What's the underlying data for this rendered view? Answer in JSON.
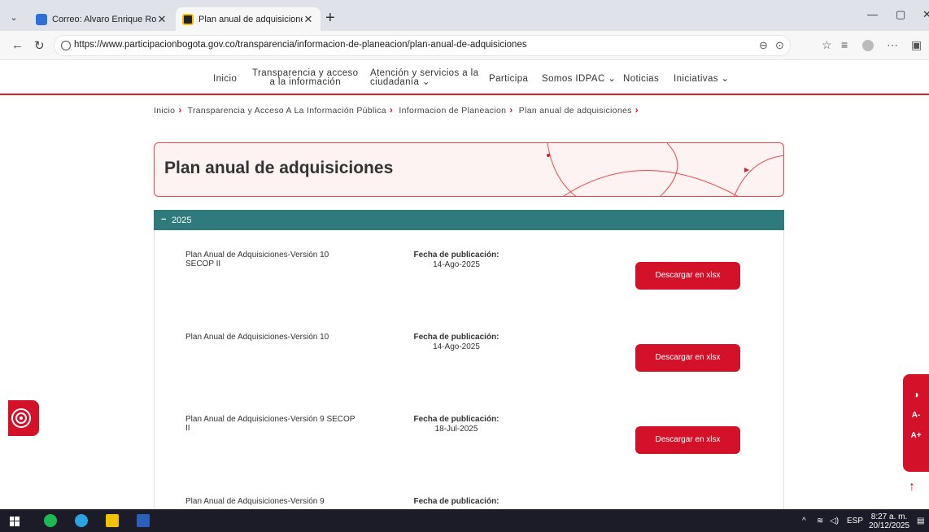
{
  "browser": {
    "tabs": [
      {
        "title": "Correo: Alvaro Enrique Romero Ga",
        "active": false
      },
      {
        "title": "Plan anual de adquisiciones | Instit",
        "active": true
      }
    ],
    "url": "https://www.participacionbogota.gov.co/transparencia/informacion-de-planeacion/plan-anual-de-adquisiciones"
  },
  "nav": {
    "inicio": "Inicio",
    "transparencia_1": "Transparencia y acceso",
    "transparencia_2": "a la información",
    "atencion_1": "Atención y servicios a la",
    "atencion_2": "ciudadanía",
    "participa": "Participa",
    "somos": "Somos IDPAC",
    "noticias": "Noticias",
    "iniciativas": "Iniciativas"
  },
  "breadcrumb": [
    "Inicio",
    "Transparencia y Acceso A La Información Pública",
    "Informacion de Planeacion",
    "Plan anual de adquisiciones"
  ],
  "page_title": "Plan anual de adquisiciones",
  "accordion": {
    "year": "2025",
    "fecha_label": "Fecha de publicación:",
    "download_label": "Descargar en xlsx",
    "items": [
      {
        "name_1": "Plan Anual de Adquisiciones-Versión 10",
        "name_2": "SECOP II",
        "date": "14-Ago-2025"
      },
      {
        "name_1": "Plan Anual de Adquisiciones-Versión 10",
        "name_2": "",
        "date": "14-Ago-2025"
      },
      {
        "name_1": "Plan Anual de Adquisiciones-Versión 9 SECOP",
        "name_2": "II",
        "date": "18-Jul-2025"
      },
      {
        "name_1": "Plan Anual de Adquisiciones-Versión 9",
        "name_2": "",
        "date": ""
      }
    ]
  },
  "a11y": {
    "contrast": "◑",
    "decrease": "A-",
    "increase": "A+"
  },
  "taskbar": {
    "lang": "ESP",
    "time": "8:27 a. m.",
    "date": "20/12/2025"
  },
  "colors": {
    "brand_red": "#d3122a",
    "accordion_teal": "#2f7a7c"
  }
}
